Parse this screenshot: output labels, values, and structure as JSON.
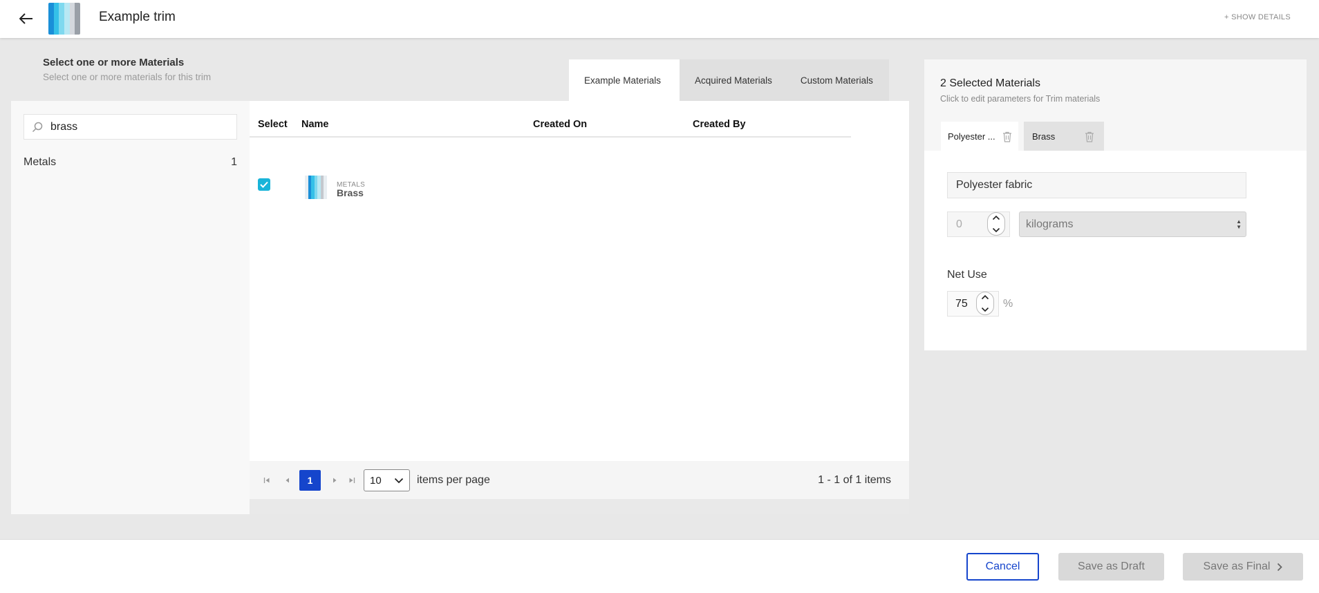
{
  "header": {
    "title": "Example trim",
    "show_details": "+ SHOW DETAILS"
  },
  "selector": {
    "title": "Select one or more Materials",
    "subtitle": "Select one or more materials for this trim"
  },
  "tabs": [
    {
      "label": "Example Materials",
      "active": true
    },
    {
      "label": "Acquired Materials",
      "active": false
    },
    {
      "label": "Custom Materials",
      "active": false
    }
  ],
  "search": {
    "value": "brass",
    "icon": "search-icon"
  },
  "facets": [
    {
      "label": "Metals",
      "count": "1"
    }
  ],
  "table": {
    "columns": [
      "Select",
      "Name",
      "Created On",
      "Created By"
    ],
    "rows": [
      {
        "checked": true,
        "category": "METALS",
        "name": "Brass",
        "created_on": "",
        "created_by": ""
      }
    ]
  },
  "pager": {
    "current_page": "1",
    "per_page": "10",
    "per_page_label": "items per page",
    "info": "1 - 1 of 1 items"
  },
  "selected": {
    "title": "2 Selected Materials",
    "subtitle": "Click to edit parameters for Trim materials",
    "chips": [
      {
        "label": "Polyester ...",
        "active": true
      },
      {
        "label": "Brass",
        "active": false
      }
    ],
    "name_value": "Polyester fabric",
    "quantity": "0",
    "unit": "kilograms",
    "net_use_label": "Net Use",
    "net_use_value": "75",
    "percent_symbol": "%"
  },
  "footer": {
    "cancel": "Cancel",
    "save_draft": "Save as Draft",
    "save_final": "Save as Final"
  },
  "colors": {
    "accent": "#1545cc",
    "checkbox": "#19b4d9",
    "disabled_button": "#d9d9d9"
  }
}
